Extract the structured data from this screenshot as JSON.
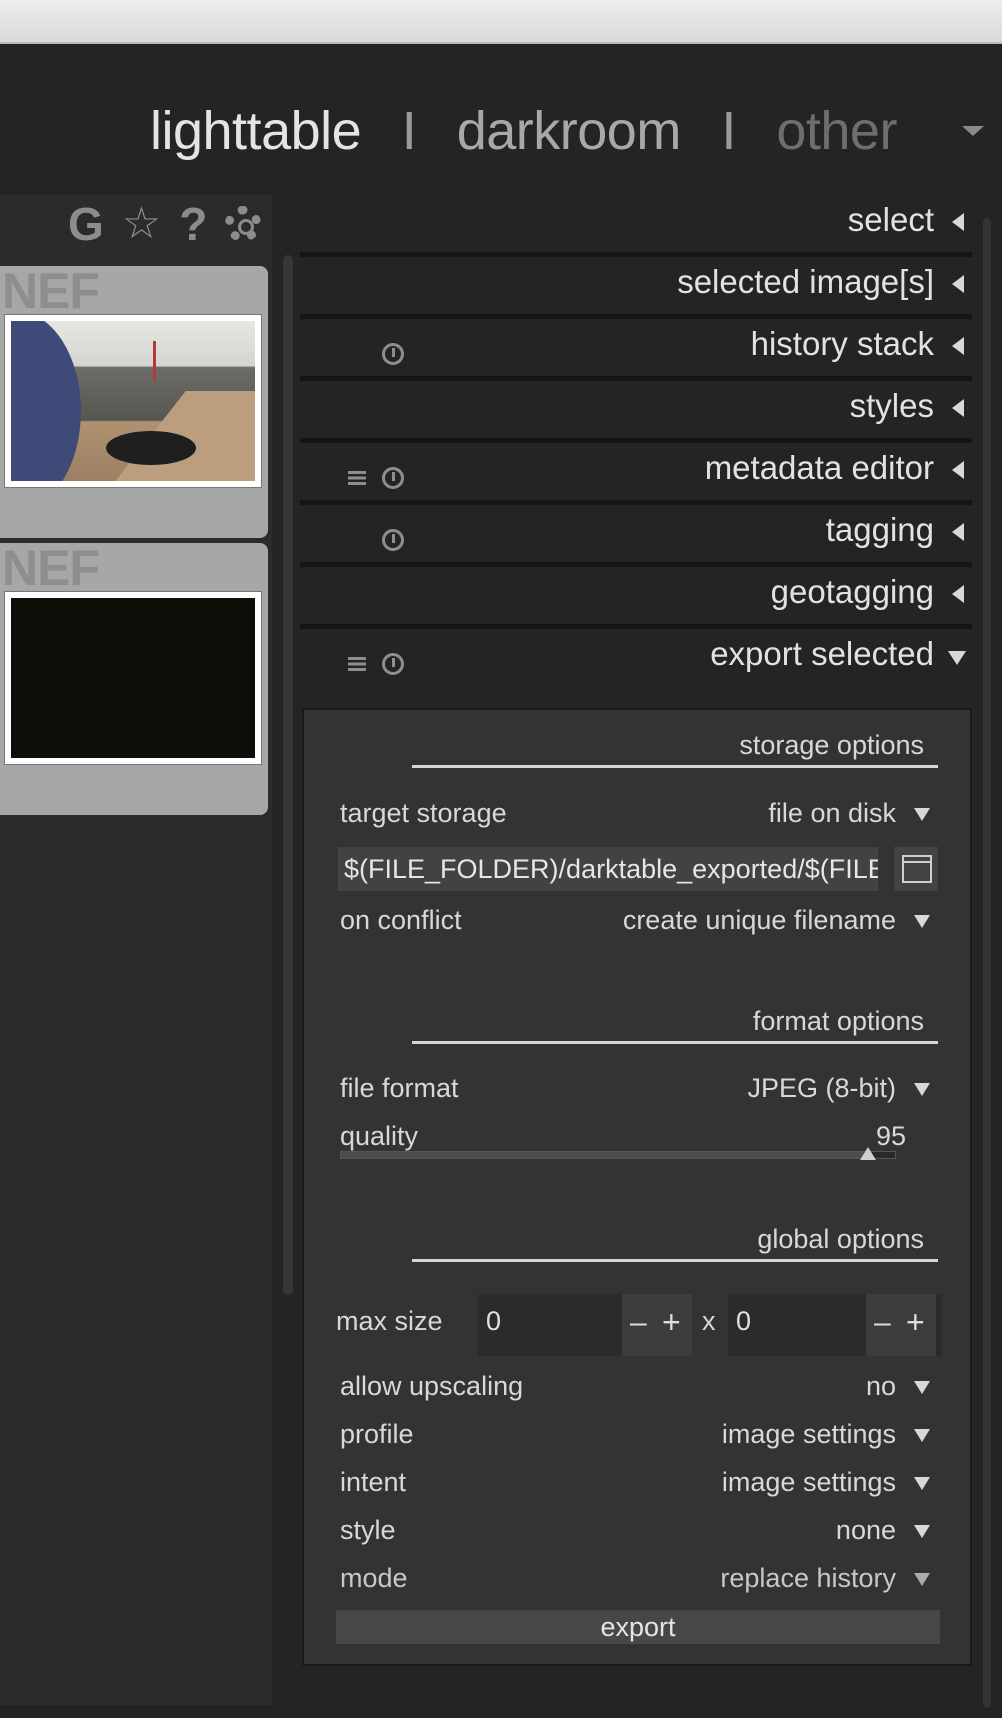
{
  "views": {
    "lighttable": "lighttable",
    "separator": "I",
    "darkroom": "darkroom",
    "other": "other"
  },
  "filmstrip": {
    "tool_icons": {
      "grouping": "G",
      "star": "☆",
      "help": "?"
    },
    "thumbnails": [
      {
        "format": "NEF"
      },
      {
        "format": "NEF"
      }
    ]
  },
  "modules": [
    {
      "label": "select"
    },
    {
      "label": "selected image[s]"
    },
    {
      "label": "history stack"
    },
    {
      "label": "styles"
    },
    {
      "label": "metadata editor"
    },
    {
      "label": "tagging"
    },
    {
      "label": "geotagging"
    },
    {
      "label": "export selected"
    }
  ],
  "export": {
    "sections": {
      "storage": "storage options",
      "format": "format options",
      "global": "global options"
    },
    "target_storage": {
      "label": "target storage",
      "value": "file on disk"
    },
    "path": "$(FILE_FOLDER)/darktable_exported/$(FILE_NAME)",
    "on_conflict": {
      "label": "on conflict",
      "value": "create unique filename"
    },
    "file_format": {
      "label": "file format",
      "value": "JPEG (8-bit)"
    },
    "quality": {
      "label": "quality",
      "value": "95",
      "fraction": 0.95
    },
    "max_size": {
      "label": "max size",
      "width": "0",
      "height": "0",
      "x": "x",
      "minus": "–",
      "plus": "+"
    },
    "allow_upscaling": {
      "label": "allow upscaling",
      "value": "no"
    },
    "profile": {
      "label": "profile",
      "value": "image settings"
    },
    "intent": {
      "label": "intent",
      "value": "image settings"
    },
    "style": {
      "label": "style",
      "value": "none"
    },
    "mode": {
      "label": "mode",
      "value": "replace history"
    },
    "export_button": "export"
  }
}
